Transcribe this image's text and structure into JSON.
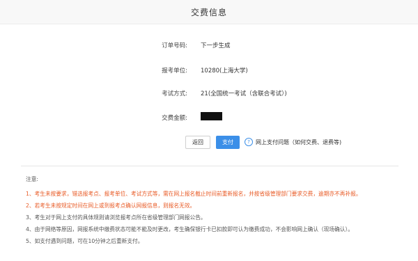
{
  "header": {
    "title": "交费信息"
  },
  "fields": [
    {
      "label": "订单号码:",
      "value": "下一步生成"
    },
    {
      "label": "报考单位:",
      "value": "10280(上海大学)"
    },
    {
      "label": "考试方式:",
      "value": "21(全国统一考试（含联合考试）)"
    },
    {
      "label": "交费金额:",
      "value": ""
    }
  ],
  "buttons": {
    "back": "返回",
    "pay": "支付"
  },
  "help": {
    "icon": "question-circle-icon",
    "text": "网上支付问题（如何交费、退费等)"
  },
  "notes": {
    "title": "注意:",
    "items": [
      "1、考生未按要求，错选报考点、报考单位、考试方式等，需在网上报名截止时间前重新报名，并按省级管理部门要求交费，逾期亦不再补报。",
      "2、若考生未按规定时间在网上或到报考点确认网报信息，则报名无效。",
      "3、考生对于网上支付的具体规则请浏览报考点所在省级管理部门网报公告。",
      "4、由于网络等原因，网报系统中缴费状态可能不能及时更改，考生确保银行卡已扣款即可认为缴费成功，不会影响网上确认（现场确认）。",
      "5、如支付遇到问题，可在10分钟之后重新支付。"
    ]
  },
  "colors": {
    "accent": "#3b8fe8",
    "warning": "#e85a25"
  }
}
